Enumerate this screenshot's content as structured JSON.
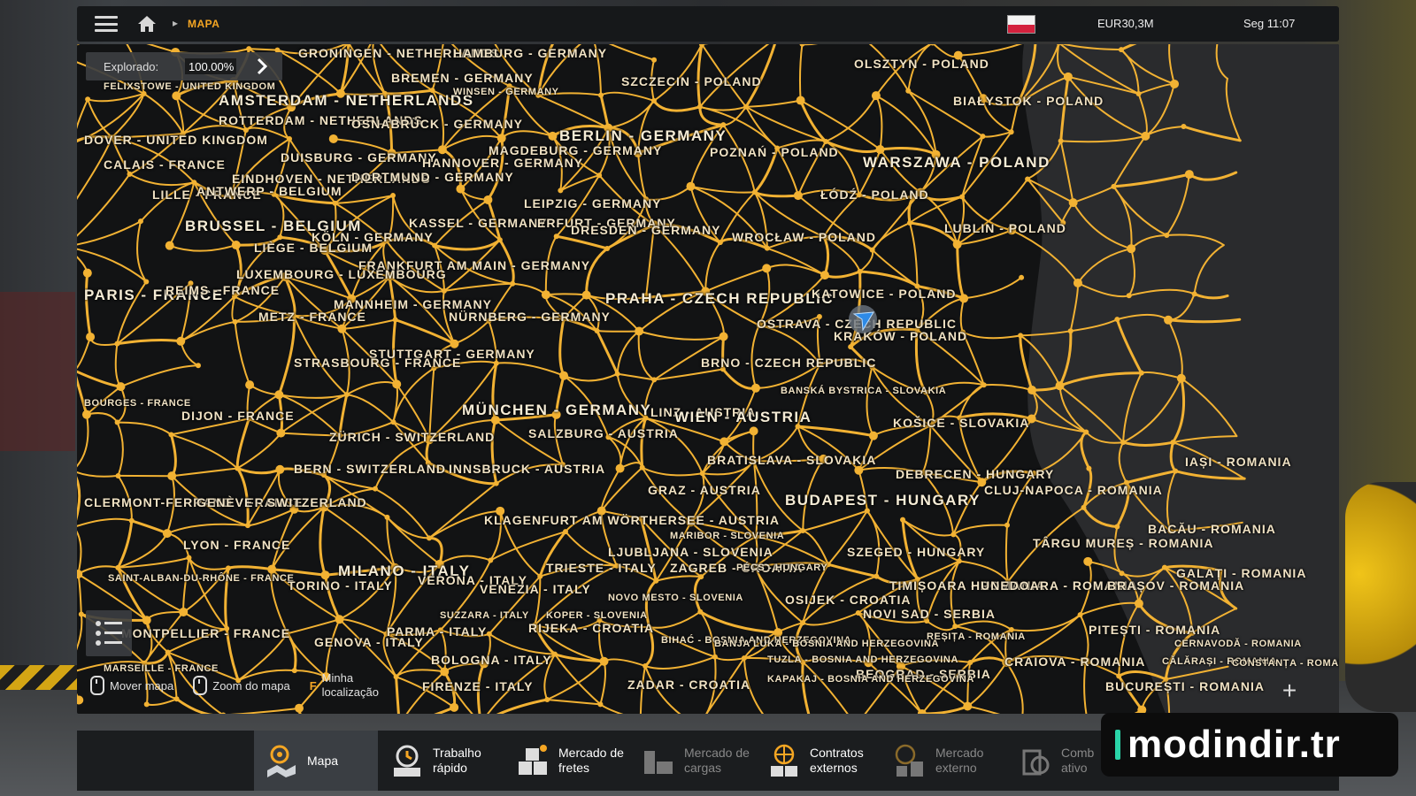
{
  "header": {
    "breadcrumb": "MAPA",
    "money": "EUR30,3M",
    "clock": "Seg 11:07"
  },
  "explored": {
    "label": "Explorado:",
    "value": "100.00%"
  },
  "colors": {
    "accent": "#f5a623",
    "road": "#f2b233",
    "map_bg": "#121314"
  },
  "cities": [
    "GRONINGEN - NETHERLANDS",
    "HAMBURG - GERMANY",
    "OLSZTYN - POLAND",
    "FELIXSTOWE - UNITED KINGDOM",
    "BREMEN - GERMANY",
    "SZCZECIN - POLAND",
    "AMSTERDAM - NETHERLANDS",
    "WINSEN - GERMANY",
    "BIAŁYSTOK - POLAND",
    "ROTTERDAM - NETHERLANDS",
    "OSNABRÜCK - GERMANY",
    "BERLIN - GERMANY",
    "DOVER - UNITED KINGDOM",
    "MAGDEBURG - GERMANY",
    "POZNAŃ - POLAND",
    "CALAIS - FRANCE",
    "DUISBURG - GERMANY",
    "HANNOVER - GERMANY",
    "WARSZAWA - POLAND",
    "EINDHOVEN - NETHERLANDS",
    "DORTMUND - GERMANY",
    "LILLE - FRANCE",
    "ANTWERP - BELGIUM",
    "LEIPZIG - GERMANY",
    "ŁÓDŹ - POLAND",
    "BRUSSEL - BELGIUM",
    "KASSEL - GERMANY",
    "ERFURT - GERMANY",
    "LUBLIN - POLAND",
    "KÖLN - GERMANY",
    "DRESDEN - GERMANY",
    "WROCŁAW - POLAND",
    "LIÈGE - BELGIUM",
    "FRANKFURT AM MAIN - GERMANY",
    "LUXEMBOURG - LUXEMBOURG",
    "PARIS - FRANCE",
    "REIMS - FRANCE",
    "PRAHA - CZECH REPUBLIC",
    "KATOWICE - POLAND",
    "MANNHEIM - GERMANY",
    "METZ - FRANCE",
    "NÜRNBERG - GERMANY",
    "OSTRAVA - CZECH REPUBLIC",
    "KRAKÓW - POLAND",
    "STUTTGART - GERMANY",
    "STRASBOURG - FRANCE",
    "BRNO - CZECH REPUBLIC",
    "BANSKÁ BYSTRICA - SLOVAKIA",
    "BOURGES - FRANCE",
    "DIJON - FRANCE",
    "MÜNCHEN - GERMANY",
    "LINZ - AUSTRIA",
    "WIEN - AUSTRIA",
    "KOŠICE - SLOVAKIA",
    "ZÜRICH - SWITZERLAND",
    "SALZBURG - AUSTRIA",
    "BRATISLAVA - SLOVAKIA",
    "IAȘI - ROMANIA",
    "BERN - SWITZERLAND",
    "INNSBRUCK - AUSTRIA",
    "DEBRECEN - HUNGARY",
    "GRAZ - AUSTRIA",
    "CLUJ-NAPOCA - ROMANIA",
    "CLERMONT-FERRAND - FRANCE",
    "GENÈVE - SWITZERLAND",
    "BUDAPEST - HUNGARY",
    "KLAGENFURT AM WÖRTHERSEE - AUSTRIA",
    "BACĂU - ROMANIA",
    "LYON - FRANCE",
    "MARIBOR - SLOVENIA",
    "TÂRGU MUREȘ - ROMANIA",
    "LJUBLJANA - SLOVENIA",
    "SZEGED - HUNGARY",
    "MILANO - ITALY",
    "TRIESTE - ITALY",
    "ZAGREB - CROATIA",
    "PÉCS - HUNGARY",
    "GALAȚI - ROMANIA",
    "SAINT-ALBAN-DU-RHÔNE - FRANCE",
    "TORINO - ITALY",
    "VERONA - ITALY",
    "VENEZIA - ITALY",
    "TIMIȘOARA - ROMANIA",
    "HUNEDOARA - ROMANIA",
    "BRAȘOV - ROMANIA",
    "NOVO MESTO - SLOVENIA",
    "OSIJEK - CROATIA",
    "SUZZARA - ITALY",
    "KOPER - SLOVENIA",
    "NOVI SAD - SERBIA",
    "PITEȘTI - ROMANIA",
    "MONTPELLIER - FRANCE",
    "PARMA - ITALY",
    "RIJEKA - CROATIA",
    "BIHAĆ - BOSNIA AND HERZEGOVINA",
    "REȘIȚA - ROMANIA",
    "GENOVA - ITALY",
    "BANJA LUKA - BOSNIA AND HERZEGOVINA",
    "CERNAVODĂ - ROMANIA",
    "BOLOGNA - ITALY",
    "TUZLA - BOSNIA AND HERZEGOVINA",
    "CRAIOVA - ROMANIA",
    "CĂLĂRAȘI - ROMANIA",
    "MARSEILLE - FRANCE",
    "BEOGRAD - SERBIA",
    "CONSTANȚA - ROMANIA",
    "KAPAKAJ - BOSNIA AND HERZEGOVINA",
    "FIRENZE - ITALY",
    "ZADAR - CROATIA",
    "BUCUREȘTI - ROMANIA"
  ],
  "hints": {
    "move_map": "Mover mapa",
    "zoom_map": "Zoom do mapa",
    "my_location_key": "F",
    "my_location": "Minha localização"
  },
  "tabs": [
    {
      "label_1": "Mapa",
      "label_2": "",
      "state": "active",
      "icon": "map-pin-icon"
    },
    {
      "label_1": "Trabalho",
      "label_2": "rápido",
      "state": "normal",
      "icon": "clock-box-icon"
    },
    {
      "label_1": "Mercado de",
      "label_2": "fretes",
      "state": "normal",
      "icon": "crates-icon"
    },
    {
      "label_1": "Mercado de",
      "label_2": "cargas",
      "state": "disabled",
      "icon": "cargo-icon"
    },
    {
      "label_1": "Contratos",
      "label_2": "externos",
      "state": "normal",
      "icon": "globe-crates-icon"
    },
    {
      "label_1": "Mercado",
      "label_2": "externo",
      "state": "disabled",
      "icon": "globe-cargo-icon"
    },
    {
      "label_1": "Comb",
      "label_2": "ativo",
      "state": "disabled",
      "icon": "fuel-icon"
    }
  ],
  "watermark": "modindir.tr"
}
